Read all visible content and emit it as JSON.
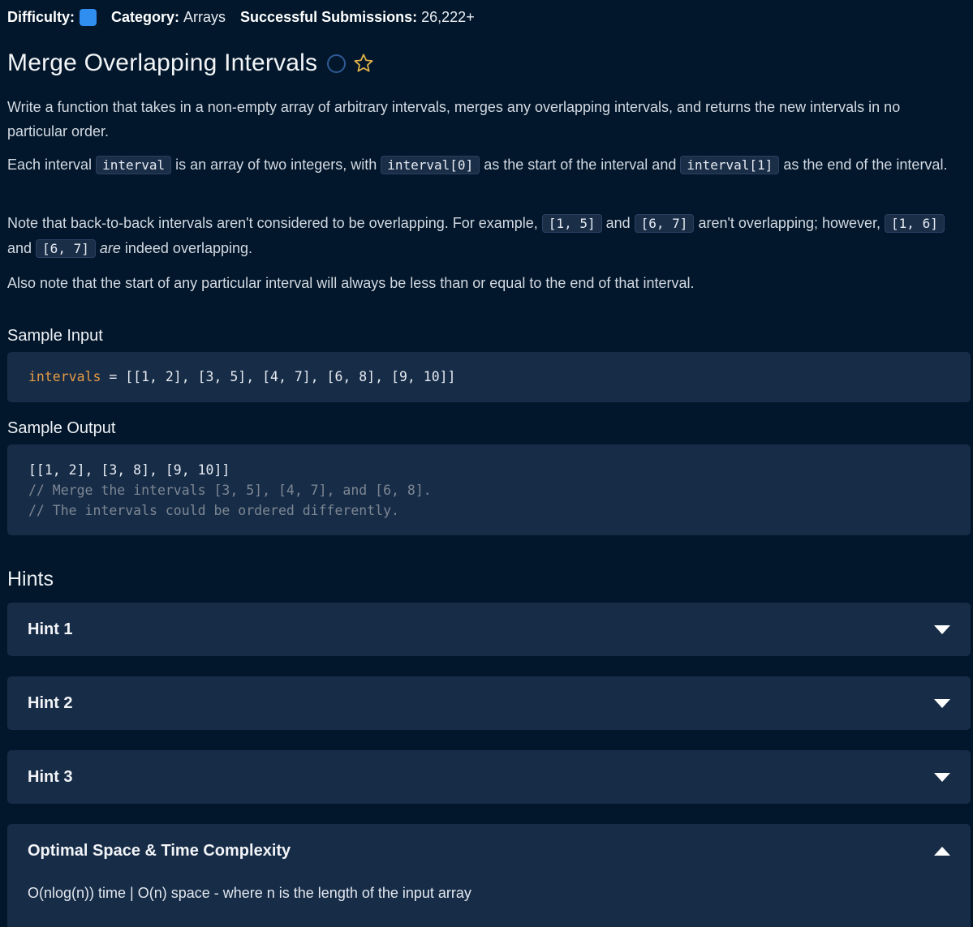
{
  "meta": {
    "difficulty_label": "Difficulty:",
    "category_label": "Category:",
    "category_value": "Arrays",
    "submissions_label": "Successful Submissions:",
    "submissions_value": "26,222+"
  },
  "problem": {
    "title": "Merge Overlapping Intervals",
    "p1": "Write a function that takes in a non-empty array of arbitrary intervals, merges any overlapping intervals, and returns the new intervals in no particular order.",
    "p2": {
      "t1": "Each interval ",
      "c1": "interval",
      "t2": " is an array of two integers, with ",
      "c2": "interval[0]",
      "t3": " as the start of the interval and ",
      "c3": "interval[1]",
      "t4": " as the end of the interval."
    },
    "p3": {
      "t1": "Note that back-to-back intervals aren't considered to be overlapping. For example, ",
      "c1": "[1, 5]",
      "t2": " and ",
      "c2": "[6, 7]",
      "t3": " aren't overlapping; however, ",
      "c3": "[1, 6]",
      "t4": " and ",
      "c4": "[6, 7]",
      "t5": " ",
      "em": "are",
      "t6": " indeed overlapping."
    },
    "p4": "Also note that the start of any particular interval will always be less than or equal to the end of that interval."
  },
  "sample_input": {
    "label": "Sample Input",
    "var_name": "intervals",
    "rest": " = [[1, 2], [3, 5], [4, 7], [6, 8], [9, 10]]"
  },
  "sample_output": {
    "label": "Sample Output",
    "line1": "[[1, 2], [3, 8], [9, 10]]",
    "line2": "// Merge the intervals [3, 5], [4, 7], and [6, 8].",
    "line3": "// The intervals could be ordered differently."
  },
  "hints": {
    "title": "Hints",
    "items": [
      {
        "label": "Hint 1"
      },
      {
        "label": "Hint 2"
      },
      {
        "label": "Hint 3"
      }
    ]
  },
  "complexity": {
    "label": "Optimal Space & Time Complexity",
    "text": "O(nlog(n)) time | O(n) space - where n is the length of the input array"
  },
  "colors": {
    "background": "#02172b",
    "panel": "#172c47",
    "difficulty_badge": "#2f8ef0",
    "star": "#e8b94a",
    "keyword": "#e69a44",
    "comment": "#7d8793"
  },
  "icons": {
    "difficulty": "difficulty-badge-icon",
    "completion": "circle-outline-icon",
    "favorite": "star-outline-icon",
    "collapsed": "caret-down-icon",
    "expanded": "caret-up-icon"
  }
}
